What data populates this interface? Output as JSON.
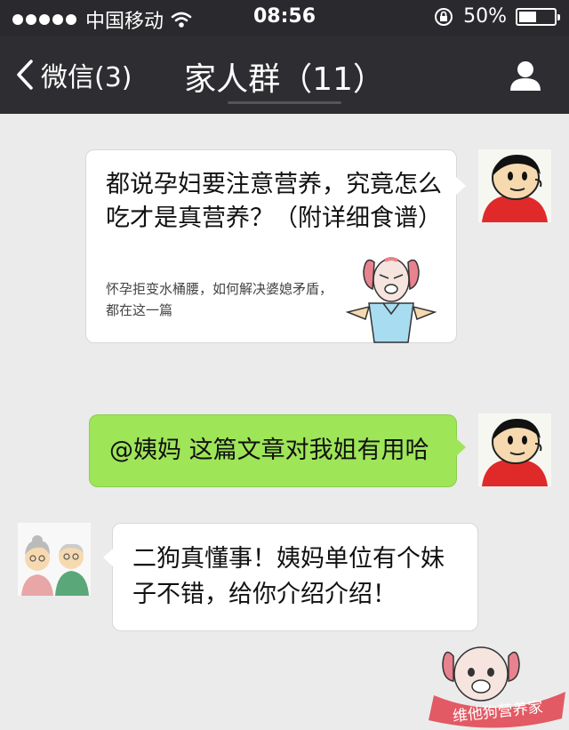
{
  "status_bar": {
    "carrier": "中国移动",
    "time": "08:56",
    "battery": "50%",
    "battery_level": 0.5
  },
  "nav": {
    "back_label": "微信(3)",
    "title": "家人群（11）"
  },
  "messages": {
    "article": {
      "title": "都说孕妇要注意营养，究竟怎么吃才是真营养？（附详细食谱）",
      "summary": "怀孕拒变水桶腰，如何解决婆媳矛盾，都在这一篇"
    },
    "sent_text": "@姨妈 这篇文章对我姐有用哈",
    "received_text": "二狗真懂事！姨妈单位有个妹子不错，给你介绍介绍！"
  },
  "watermark": {
    "text": "维他狗营养家"
  },
  "colors": {
    "nav_background": "#2e2e32",
    "chat_background": "#ebebeb",
    "sent_bubble": "#9ee558"
  }
}
